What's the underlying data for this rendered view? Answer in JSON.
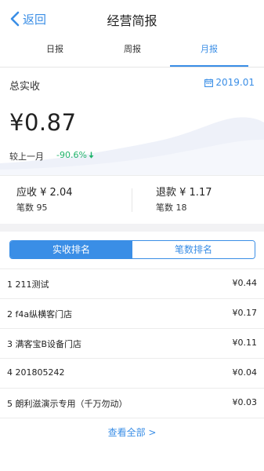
{
  "header": {
    "back_label": "返回",
    "title": "经营简报"
  },
  "tabs": [
    {
      "label": "日报",
      "active": false
    },
    {
      "label": "周报",
      "active": false
    },
    {
      "label": "月报",
      "active": true
    }
  ],
  "summary": {
    "label": "总实收",
    "date": "2019.01",
    "amount": "¥0.87",
    "compare_label": "较上一月",
    "compare_value": "-90.6%",
    "compare_direction": "down"
  },
  "stats": {
    "receivable_label": "应收 ¥ 2.04",
    "receivable_count": "笔数 95",
    "refund_label": "退款 ¥ 1.17",
    "refund_count": "笔数 18"
  },
  "ranking_tabs": [
    {
      "label": "实收排名",
      "active": true
    },
    {
      "label": "笔数排名",
      "active": false
    }
  ],
  "ranking": [
    {
      "name": "1 211测试",
      "value": "¥0.44"
    },
    {
      "name": "2 f4a纵横客门店",
      "value": "¥0.17"
    },
    {
      "name": "3 满客宝B设备门店",
      "value": "¥0.11"
    },
    {
      "name": "4 201805242",
      "value": "¥0.04"
    },
    {
      "name": "5 朗利滋演示专用（千万勿动）",
      "value": "¥0.03"
    }
  ],
  "more_label": "查看全部 >",
  "colors": {
    "accent": "#3a8ee6",
    "positive_down": "#1fb36b",
    "divider": "#ececec",
    "gap": "#f2f2f4"
  },
  "icons": {
    "back": "chevron-left-icon",
    "date": "calendar-icon",
    "trend": "arrow-down-icon"
  }
}
